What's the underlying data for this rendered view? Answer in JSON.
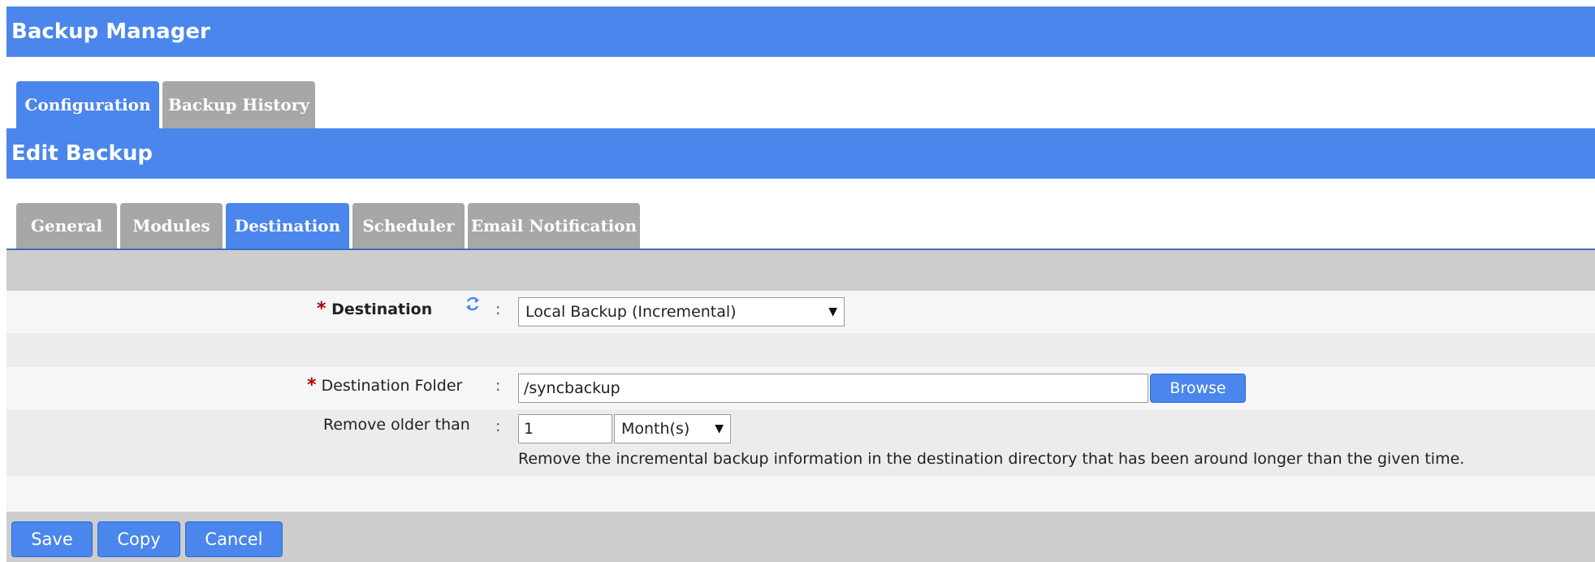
{
  "app": {
    "title": "Backup Manager"
  },
  "main_tabs": [
    {
      "label": "Configuration",
      "active": true
    },
    {
      "label": "Backup History",
      "active": false
    }
  ],
  "section": {
    "title": "Edit Backup"
  },
  "sub_tabs": [
    {
      "label": "General",
      "active": false
    },
    {
      "label": "Modules",
      "active": false
    },
    {
      "label": "Destination",
      "active": true
    },
    {
      "label": "Scheduler",
      "active": false
    },
    {
      "label": "Email Notification",
      "active": false
    }
  ],
  "form": {
    "required_mark": "*",
    "colon": ":",
    "destination": {
      "label": "Destination",
      "value": "Local Backup (Incremental)",
      "refresh_icon": "refresh-icon"
    },
    "destination_folder": {
      "label": "Destination Folder",
      "value": "/syncbackup",
      "browse_label": "Browse"
    },
    "remove_older": {
      "label": "Remove older than",
      "value": "1",
      "unit": "Month(s)",
      "help": "Remove the incremental backup information in the destination directory that has been around longer than the given time."
    }
  },
  "actions": {
    "save_label": "Save",
    "copy_label": "Copy",
    "cancel_label": "Cancel"
  },
  "colors": {
    "accent": "#4a86ec",
    "tab_inactive": "#a7a7a7",
    "required": "#b00000"
  }
}
